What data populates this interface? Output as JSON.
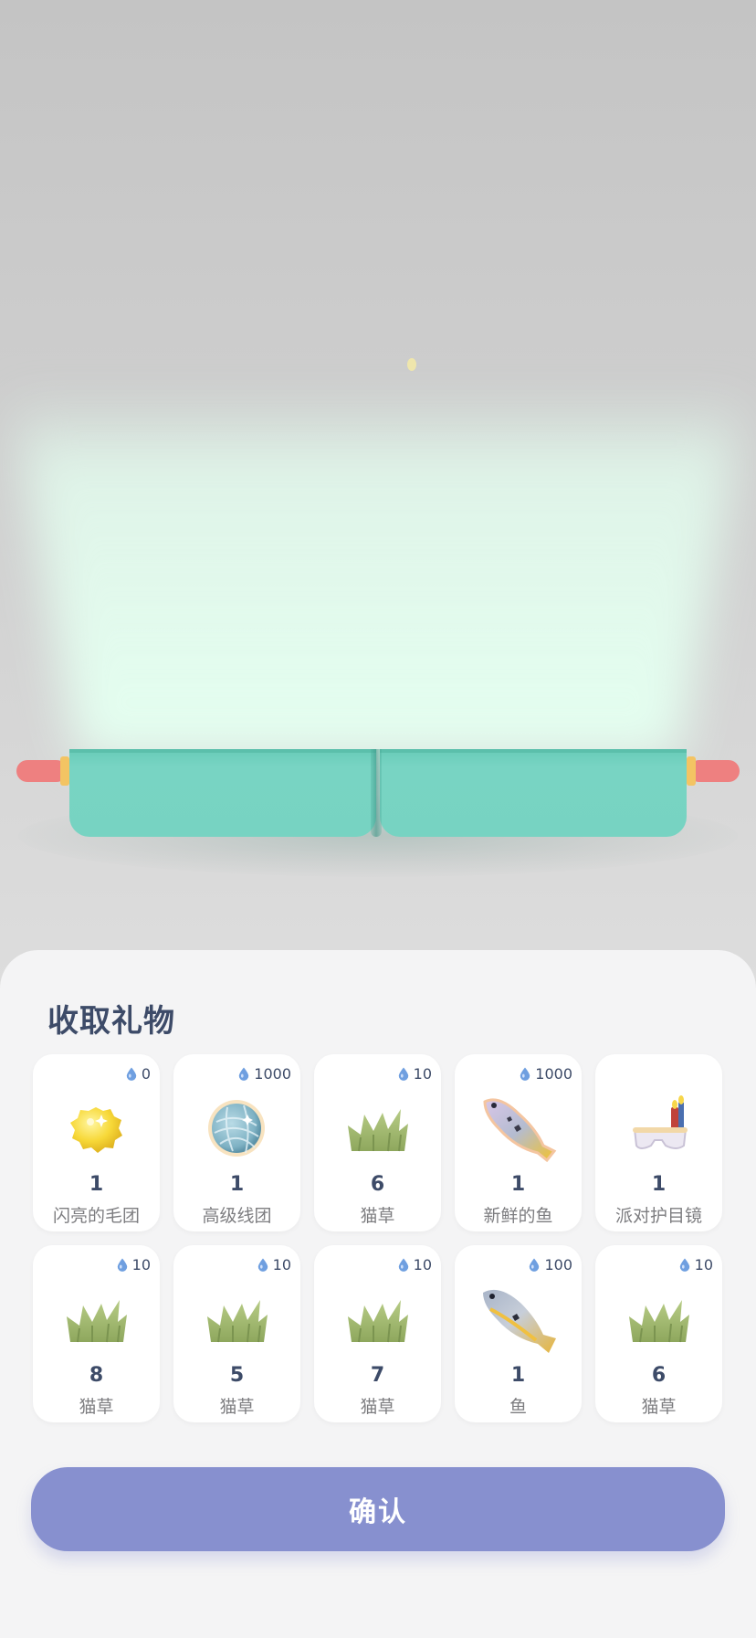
{
  "sheet": {
    "title": "收取礼物",
    "confirm_label": "确认"
  },
  "items": [
    {
      "cost": "0",
      "qty": "1",
      "name": "闪亮的毛团",
      "icon": "shiny-furball-icon"
    },
    {
      "cost": "1000",
      "qty": "1",
      "name": "高级线团",
      "icon": "premium-yarn-ball-icon"
    },
    {
      "cost": "10",
      "qty": "6",
      "name": "猫草",
      "icon": "catgrass-icon"
    },
    {
      "cost": "1000",
      "qty": "1",
      "name": "新鲜的鱼",
      "icon": "fresh-fish-icon"
    },
    {
      "cost": "",
      "qty": "1",
      "name": "派对护目镜",
      "icon": "party-goggles-icon"
    },
    {
      "cost": "10",
      "qty": "8",
      "name": "猫草",
      "icon": "catgrass-icon"
    },
    {
      "cost": "10",
      "qty": "5",
      "name": "猫草",
      "icon": "catgrass-icon"
    },
    {
      "cost": "10",
      "qty": "7",
      "name": "猫草",
      "icon": "catgrass-icon"
    },
    {
      "cost": "100",
      "qty": "1",
      "name": "鱼",
      "icon": "fish-icon"
    },
    {
      "cost": "10",
      "qty": "6",
      "name": "猫草",
      "icon": "catgrass-icon"
    }
  ],
  "colors": {
    "title_text": "#3d4b68",
    "confirm_button": "#8790cf",
    "gift_box": "#77d3c2",
    "box_rod": "#ee8080",
    "glow": "#e4fff0"
  }
}
